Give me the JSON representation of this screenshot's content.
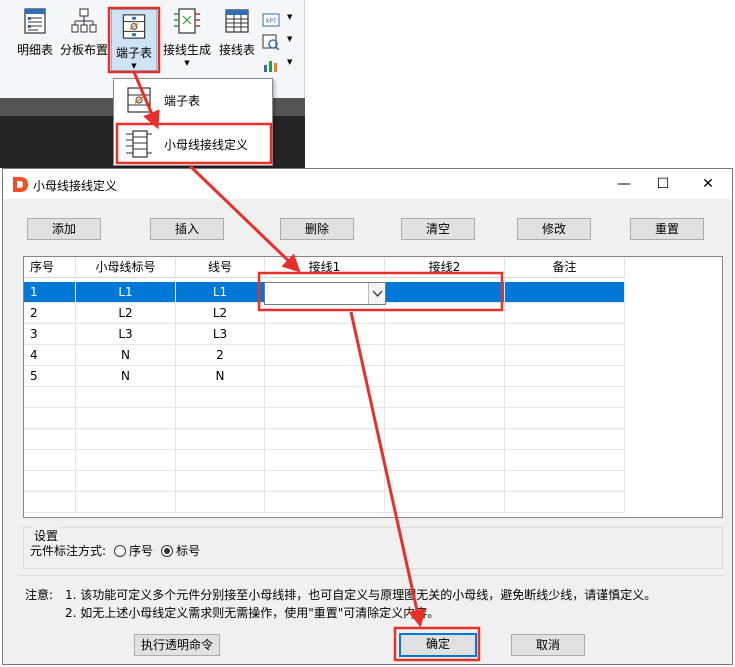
{
  "ribbon": {
    "buttons": [
      {
        "label": "明细表",
        "icon": "table-list-icon"
      },
      {
        "label": "分板布置",
        "icon": "board-layout-icon"
      },
      {
        "label": "端子表",
        "icon": "terminal-table-icon"
      },
      {
        "label": "接线生成",
        "icon": "wiring-generate-icon"
      },
      {
        "label": "接线表",
        "icon": "wiring-table-icon"
      }
    ],
    "mini_label": "XPT"
  },
  "menu": {
    "items": [
      {
        "label": "端子表"
      },
      {
        "label": "小母线接线定义"
      }
    ]
  },
  "dialog": {
    "title": "小母线接线定义",
    "controls": {
      "minimize": "—",
      "maximize": "☐",
      "close": "✕"
    },
    "toolbar": {
      "add": "添加",
      "insert": "插入",
      "delete": "删除",
      "clear": "清空",
      "modify": "修改",
      "reset": "重置"
    },
    "grid": {
      "columns": [
        "序号",
        "小母线标号",
        "线号",
        "接线1",
        "接线2",
        "备注"
      ],
      "rows": [
        [
          "1",
          "L1",
          "L1",
          "",
          "",
          ""
        ],
        [
          "2",
          "L2",
          "L2",
          "",
          "",
          ""
        ],
        [
          "3",
          "L3",
          "L3",
          "",
          "",
          ""
        ],
        [
          "4",
          "N",
          "2",
          "",
          "",
          ""
        ],
        [
          "5",
          "N",
          "N",
          "",
          "",
          ""
        ]
      ],
      "selected_row": 0
    },
    "settings": {
      "title": "设置",
      "label": "元件标注方式:",
      "option_serial": "序号",
      "option_tag": "标号",
      "selected": "标号"
    },
    "notes": {
      "label": "注意:",
      "line1": "1. 该功能可定义多个元件分别接至小母线排，也可自定义与原理图无关的小母线，避免断线少线，请谨慎定义。",
      "line2": "2. 如无上述小母线定义需求则无需操作，使用\"重置\"可清除定义内容。"
    },
    "footer": {
      "exec": "执行透明命令",
      "ok": "确定",
      "cancel": "取消"
    }
  },
  "colors": {
    "selection": "#0078d7",
    "highlight": "#e8302a",
    "logo": "#f04e23"
  }
}
